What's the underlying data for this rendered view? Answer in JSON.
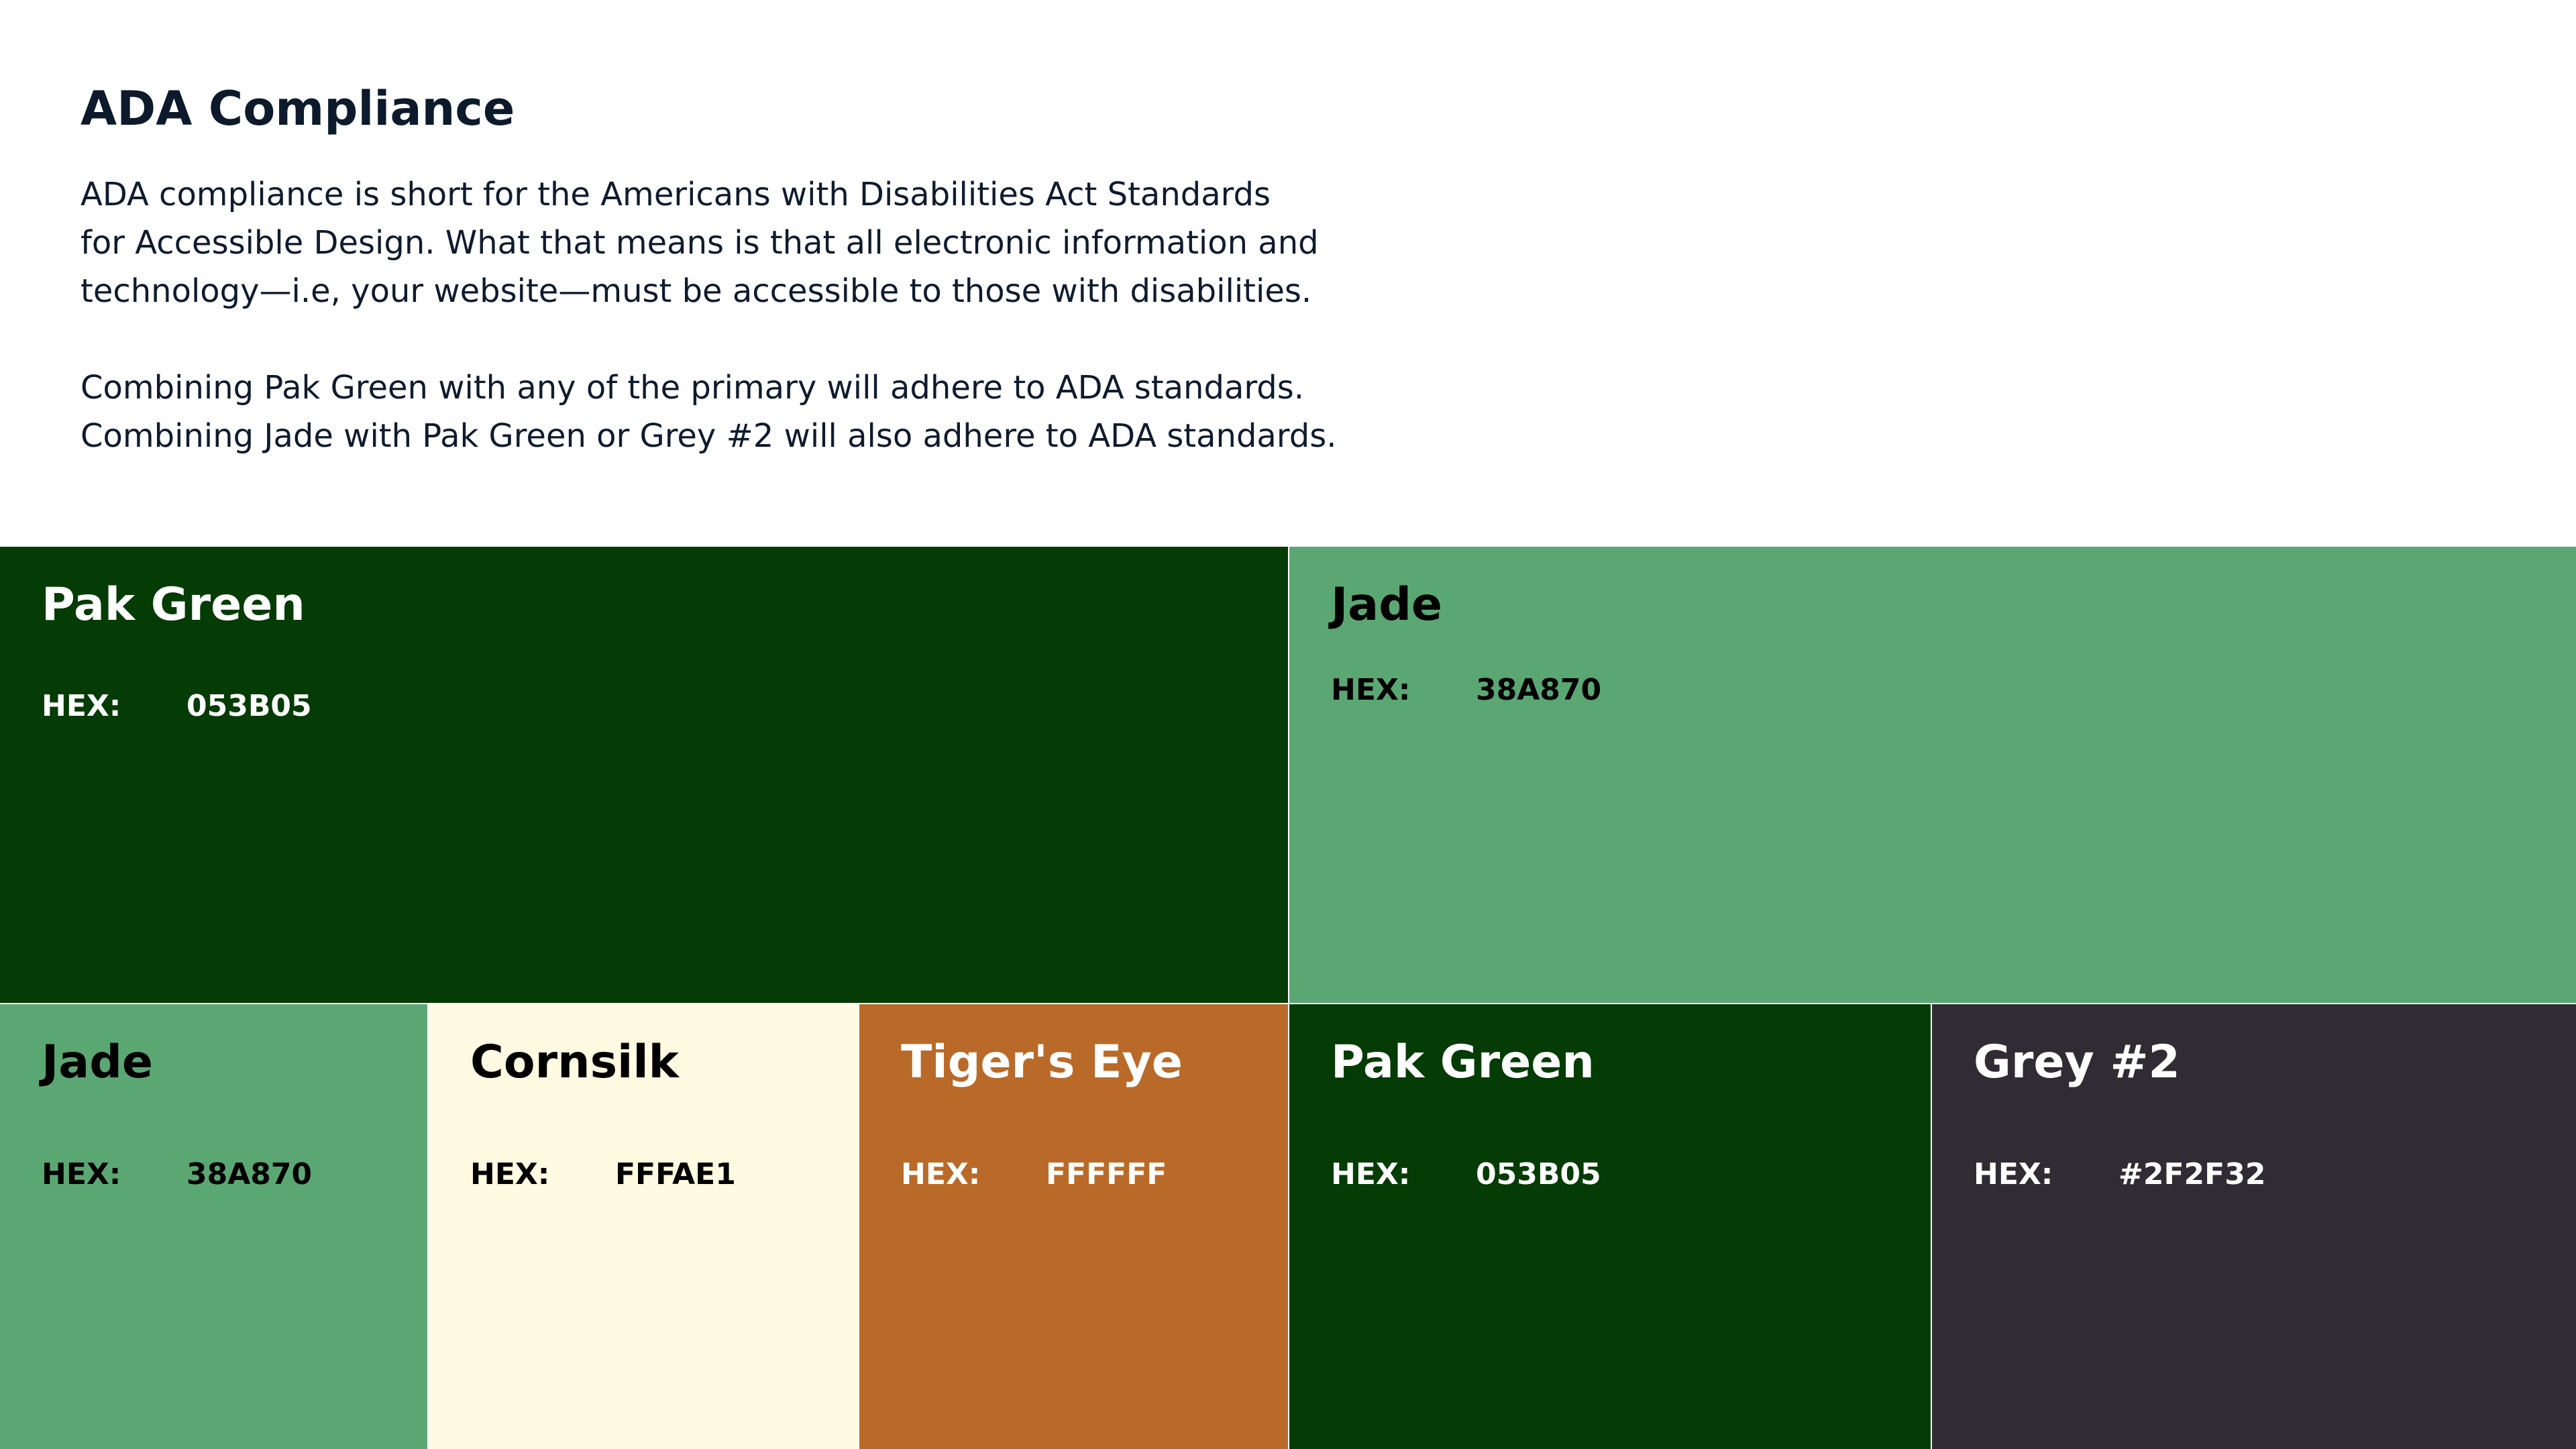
{
  "header": {
    "title": "ADA Compliance",
    "paragraph1": "ADA compliance is short for the Americans with Disabilities Act Standards\nfor Accessible Design. What that means is that all electronic information and\ntechnology—i.e, your website—must be accessible to those with disabilities.",
    "paragraph2": "Combining Pak Green with any of the primary will adhere to ADA standards.\nCombining Jade with Pak Green or Grey #2 will also adhere to ADA standards."
  },
  "swatches": [
    {
      "name": "Pak Green",
      "hex_label": "HEX:",
      "hex_value": "053B05",
      "bg": "#053B05",
      "fg": "#ffffff"
    },
    {
      "name": "Jade",
      "hex_label": "HEX:",
      "hex_value": "38A870",
      "bg": "#5BA774",
      "fg": "#000000"
    },
    {
      "name": "Jade",
      "hex_label": "HEX:",
      "hex_value": "38A870",
      "bg": "#5BA774",
      "fg": "#000000"
    },
    {
      "name": "Cornsilk",
      "hex_label": "HEX:",
      "hex_value": "FFFAE1",
      "bg": "#FFFAE1",
      "fg": "#000000"
    },
    {
      "name": "Tiger's Eye",
      "hex_label": "HEX:",
      "hex_value": "FFFFFF",
      "bg": "#BA6A28",
      "fg": "#ffffff"
    },
    {
      "name": "Pak Green",
      "hex_label": "HEX:",
      "hex_value": "053B05",
      "bg": "#053B05",
      "fg": "#ffffff"
    },
    {
      "name": "Grey #2",
      "hex_label": "HEX:",
      "hex_value": "#2F2F32",
      "bg": "#2F2D33",
      "fg": "#ffffff"
    }
  ]
}
